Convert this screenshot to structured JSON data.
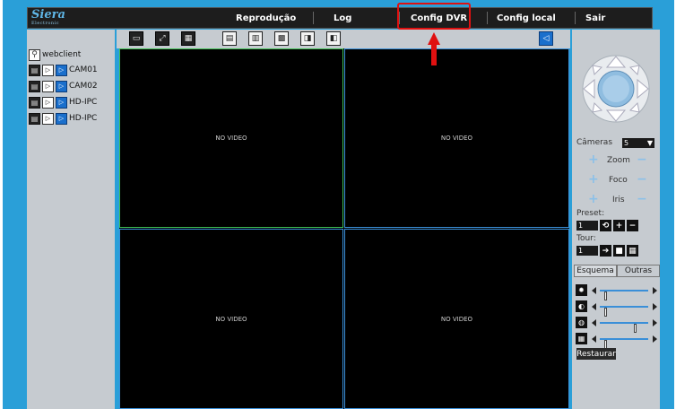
{
  "brand": {
    "name": "Siera",
    "tagline": "Electronic"
  },
  "menu": {
    "items": [
      {
        "label": "Reprodução"
      },
      {
        "label": "Log"
      },
      {
        "label": "Config DVR"
      },
      {
        "label": "Config local"
      },
      {
        "label": "Sair"
      }
    ],
    "highlighted": "Config DVR",
    "highlight_color": "#e01010"
  },
  "device_tree": {
    "root": "webclient",
    "channels": [
      "CAM01",
      "CAM02",
      "HD-IPC",
      "HD-IPC"
    ]
  },
  "toolbar": {
    "icons": [
      "monitor-icon",
      "fullscreen-icon",
      "quad-layout-icon",
      "record-icon",
      "snapshot-icon",
      "film-icon",
      "camera-switch-icon",
      "camera-off-icon",
      "audio-icon"
    ]
  },
  "video_grid": {
    "cells": [
      {
        "status": "NO VIDEO"
      },
      {
        "status": "NO VIDEO"
      },
      {
        "status": "NO VIDEO"
      },
      {
        "status": "NO VIDEO"
      }
    ]
  },
  "ptz": {
    "cameras_label": "Câmeras",
    "camera_value": "5",
    "zoom_label": "Zoom",
    "focus_label": "Foco",
    "iris_label": "Iris",
    "preset_label": "Preset:",
    "preset_value": "1",
    "tour_label": "Tour:",
    "tour_value": "1"
  },
  "image_settings": {
    "tabs": [
      {
        "label": "Esquema"
      },
      {
        "label": "Outras"
      }
    ],
    "sliders": [
      {
        "icon": "brightness-icon",
        "value": 0.1
      },
      {
        "icon": "contrast-icon",
        "value": 0.1
      },
      {
        "icon": "saturation-icon",
        "value": 0.75
      },
      {
        "icon": "sharpness-icon",
        "value": 0.1
      }
    ],
    "restore_label": "Restaurar"
  },
  "colors": {
    "frame": "#2a9fd8",
    "panel": "#c6cbd0",
    "topbar": "#1d1d1d",
    "selected_cell_border": "#3fbf55",
    "cell_border": "#3a8fd8"
  }
}
